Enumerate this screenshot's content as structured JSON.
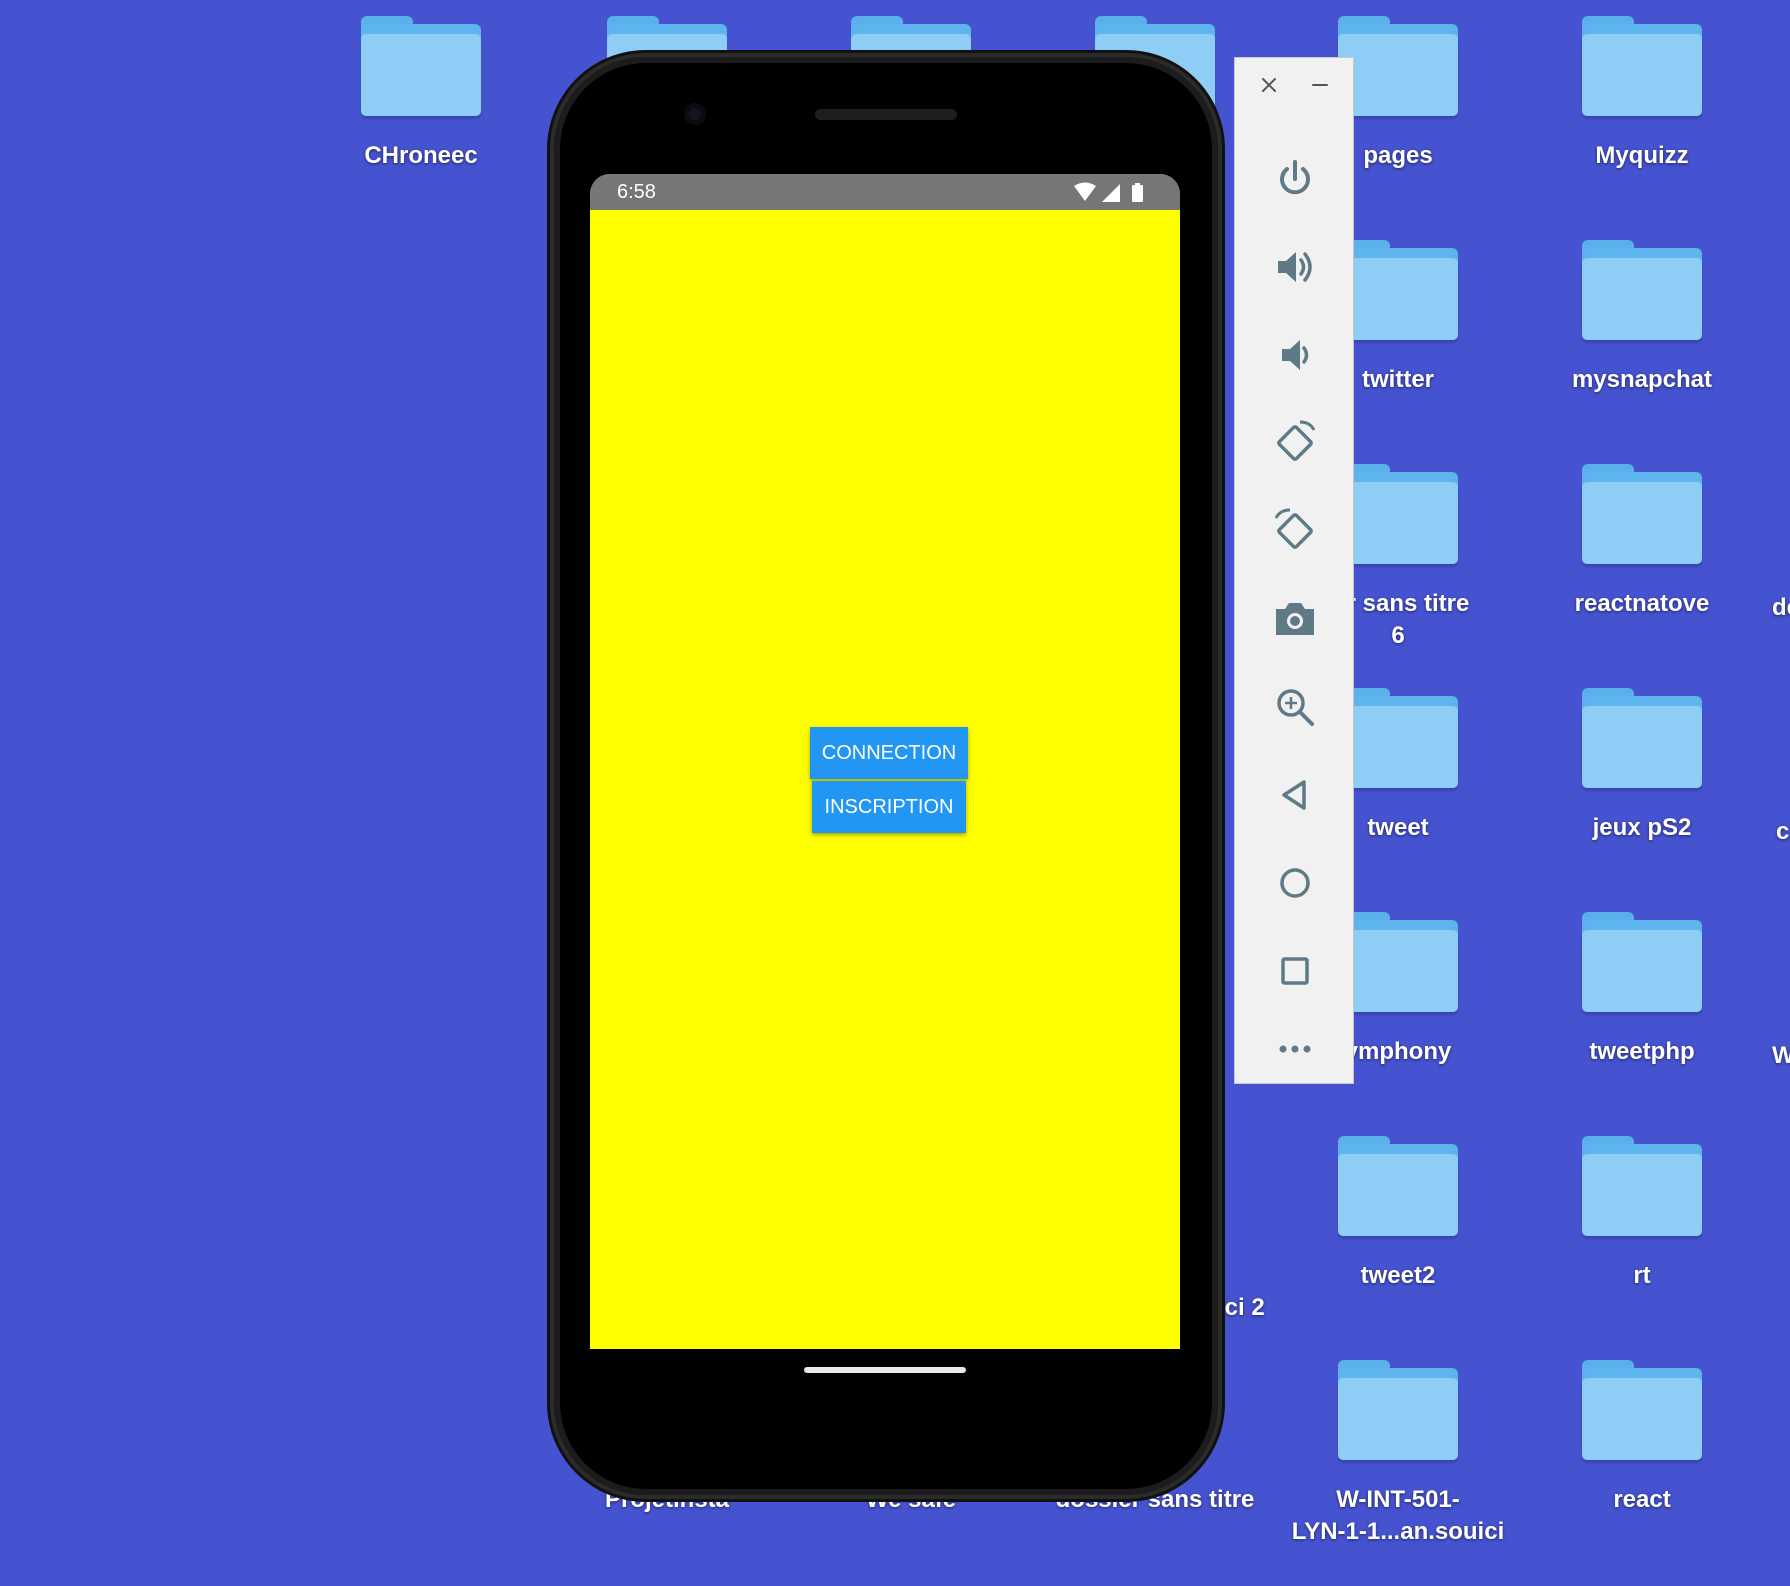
{
  "desktop": {
    "items": [
      {
        "label": "CHroneec"
      },
      {
        "label": "pages"
      },
      {
        "label": "Myquizz"
      },
      {
        "label": "twitter"
      },
      {
        "label": "mysnapchat"
      },
      {
        "label": "ier sans titre\n6"
      },
      {
        "label": "reactnatove"
      },
      {
        "label": "de"
      },
      {
        "label": "tweet"
      },
      {
        "label": "jeux pS2"
      },
      {
        "label": "c"
      },
      {
        "label": "ymphony"
      },
      {
        "label": "tweetphp"
      },
      {
        "label": "W"
      },
      {
        "label": "tweet2"
      },
      {
        "label": "rt"
      },
      {
        "label": "W-INT-501-\nLYN-1-1...an.souici"
      },
      {
        "label": "react"
      },
      {
        "label": "Projetinsta"
      },
      {
        "label": "We safe"
      },
      {
        "label": "dossier sans titre"
      },
      {
        "label": "ici 2"
      }
    ]
  },
  "phone": {
    "status_bar": {
      "time": "6:58",
      "icons": [
        "wifi-icon",
        "signal-icon",
        "battery-icon"
      ]
    },
    "app": {
      "background_color": "#ffff00",
      "buttons": {
        "connection": "CONNECTION",
        "inscription": "INSCRIPTION"
      },
      "button_color": "#2196f3"
    }
  },
  "emulator_toolbar": {
    "window_controls": [
      "close-icon",
      "minimize-icon"
    ],
    "buttons": [
      "power-icon",
      "volume-up-icon",
      "volume-down-icon",
      "rotate-left-icon",
      "rotate-right-icon",
      "camera-icon",
      "zoom-icon",
      "back-icon",
      "home-icon",
      "overview-icon",
      "more-icon"
    ]
  }
}
